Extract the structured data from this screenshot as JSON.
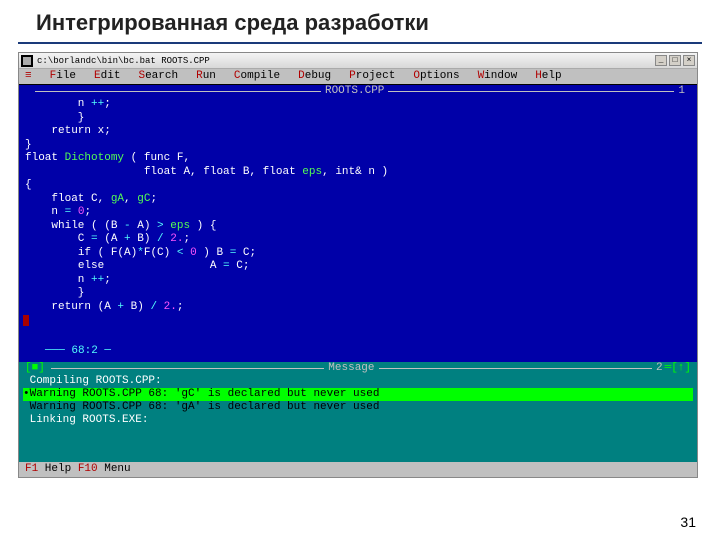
{
  "slide": {
    "title": "Интегрированная среда разработки",
    "page_number": "31"
  },
  "window": {
    "title": "c:\\borlandc\\bin\\bc.bat ROOTS.CPP",
    "buttons": {
      "min": "_",
      "max": "□",
      "close": "×"
    }
  },
  "menubar": [
    {
      "hot": "≡",
      "rest": ""
    },
    {
      "hot": "F",
      "rest": "ile"
    },
    {
      "hot": "E",
      "rest": "dit"
    },
    {
      "hot": "S",
      "rest": "earch"
    },
    {
      "hot": "R",
      "rest": "un"
    },
    {
      "hot": "C",
      "rest": "ompile"
    },
    {
      "hot": "D",
      "rest": "ebug"
    },
    {
      "hot": "P",
      "rest": "roject"
    },
    {
      "hot": "O",
      "rest": "ptions"
    },
    {
      "hot": "W",
      "rest": "indow"
    },
    {
      "hot": "H",
      "rest": "elp"
    }
  ],
  "editor": {
    "file_title": "ROOTS.CPP",
    "window_number": "1",
    "status": "68:2",
    "code_lines": [
      [
        {
          "c": "pn",
          "t": "        n "
        },
        {
          "c": "op",
          "t": "++"
        },
        {
          "c": "pn",
          "t": ";"
        }
      ],
      [
        {
          "c": "pn",
          "t": "        }"
        }
      ],
      [
        {
          "c": "kw",
          "t": "    return"
        },
        {
          "c": "pn",
          "t": " x;"
        }
      ],
      [
        {
          "c": "pn",
          "t": "}"
        }
      ],
      [
        {
          "c": "",
          "t": ""
        }
      ],
      [
        {
          "c": "ty",
          "t": "float"
        },
        {
          "c": "pn",
          "t": " "
        },
        {
          "c": "id",
          "t": "Dichotomy"
        },
        {
          "c": "pn",
          "t": " ( "
        },
        {
          "c": "ty",
          "t": "func"
        },
        {
          "c": "pn",
          "t": " F,"
        }
      ],
      [
        {
          "c": "pn",
          "t": "                  "
        },
        {
          "c": "ty",
          "t": "float"
        },
        {
          "c": "pn",
          "t": " A, "
        },
        {
          "c": "ty",
          "t": "float"
        },
        {
          "c": "pn",
          "t": " B, "
        },
        {
          "c": "ty",
          "t": "float"
        },
        {
          "c": "pn",
          "t": " "
        },
        {
          "c": "id",
          "t": "eps"
        },
        {
          "c": "pn",
          "t": ", "
        },
        {
          "c": "ty",
          "t": "int"
        },
        {
          "c": "pn",
          "t": "& n )"
        }
      ],
      [
        {
          "c": "pn",
          "t": "{"
        }
      ],
      [
        {
          "c": "pn",
          "t": "    "
        },
        {
          "c": "ty",
          "t": "float"
        },
        {
          "c": "pn",
          "t": " C, "
        },
        {
          "c": "id",
          "t": "gA"
        },
        {
          "c": "pn",
          "t": ", "
        },
        {
          "c": "id",
          "t": "gC"
        },
        {
          "c": "pn",
          "t": ";"
        }
      ],
      [
        {
          "c": "pn",
          "t": "    n "
        },
        {
          "c": "op",
          "t": "="
        },
        {
          "c": "pn",
          "t": " "
        },
        {
          "c": "num",
          "t": "0"
        },
        {
          "c": "pn",
          "t": ";"
        }
      ],
      [
        {
          "c": "pn",
          "t": "    "
        },
        {
          "c": "kw",
          "t": "while"
        },
        {
          "c": "pn",
          "t": " ( (B "
        },
        {
          "c": "op",
          "t": "-"
        },
        {
          "c": "pn",
          "t": " A) "
        },
        {
          "c": "op",
          "t": ">"
        },
        {
          "c": "pn",
          "t": " "
        },
        {
          "c": "id",
          "t": "eps"
        },
        {
          "c": "pn",
          "t": " ) {"
        }
      ],
      [
        {
          "c": "pn",
          "t": "        C "
        },
        {
          "c": "op",
          "t": "="
        },
        {
          "c": "pn",
          "t": " (A "
        },
        {
          "c": "op",
          "t": "+"
        },
        {
          "c": "pn",
          "t": " B) "
        },
        {
          "c": "op",
          "t": "/"
        },
        {
          "c": "pn",
          "t": " "
        },
        {
          "c": "num",
          "t": "2."
        },
        {
          "c": "pn",
          "t": ";"
        }
      ],
      [
        {
          "c": "pn",
          "t": "        "
        },
        {
          "c": "kw",
          "t": "if"
        },
        {
          "c": "pn",
          "t": " ( F(A)"
        },
        {
          "c": "op",
          "t": "*"
        },
        {
          "c": "pn",
          "t": "F(C) "
        },
        {
          "c": "op",
          "t": "<"
        },
        {
          "c": "pn",
          "t": " "
        },
        {
          "c": "num",
          "t": "0"
        },
        {
          "c": "pn",
          "t": " ) B "
        },
        {
          "c": "op",
          "t": "="
        },
        {
          "c": "pn",
          "t": " C;"
        }
      ],
      [
        {
          "c": "pn",
          "t": "        "
        },
        {
          "c": "kw",
          "t": "else"
        },
        {
          "c": "pn",
          "t": "                A "
        },
        {
          "c": "op",
          "t": "="
        },
        {
          "c": "pn",
          "t": " C;"
        }
      ],
      [
        {
          "c": "pn",
          "t": "        n "
        },
        {
          "c": "op",
          "t": "++"
        },
        {
          "c": "pn",
          "t": ";"
        }
      ],
      [
        {
          "c": "pn",
          "t": "        }"
        }
      ],
      [
        {
          "c": "pn",
          "t": "    "
        },
        {
          "c": "kw",
          "t": "return"
        },
        {
          "c": "pn",
          "t": " (A "
        },
        {
          "c": "op",
          "t": "+"
        },
        {
          "c": "pn",
          "t": " B) "
        },
        {
          "c": "op",
          "t": "/"
        },
        {
          "c": "pn",
          "t": " "
        },
        {
          "c": "num",
          "t": "2."
        },
        {
          "c": "pn",
          "t": ";"
        }
      ]
    ]
  },
  "messages": {
    "title": "Message",
    "window_number": "2",
    "lines": [
      {
        "kind": "compile",
        "text": " Compiling ROOTS.CPP:"
      },
      {
        "kind": "selected",
        "text": "•Warning ROOTS.CPP 68: 'gC' is declared but never used"
      },
      {
        "kind": "warn",
        "text": " Warning ROOTS.CPP 68: 'gA' is declared but never used"
      },
      {
        "kind": "link",
        "text": " Linking ROOTS.EXE:"
      }
    ]
  },
  "statusbar": {
    "f1_hot": "F1",
    "f1_text": " Help  ",
    "f10_hot": "F10",
    "f10_text": " Menu"
  }
}
